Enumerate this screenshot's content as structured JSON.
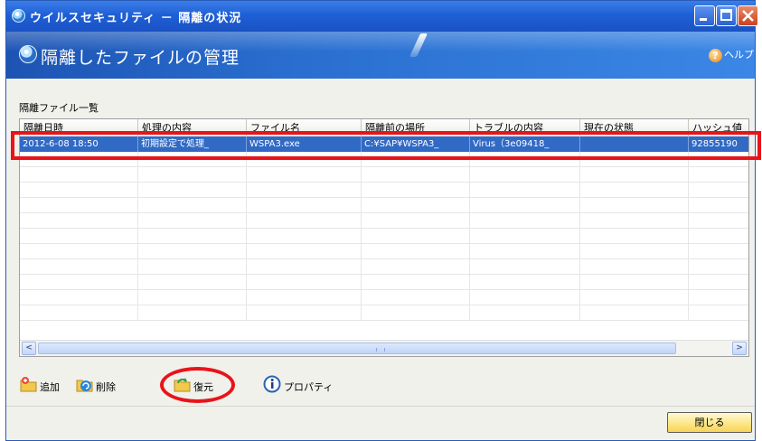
{
  "window": {
    "title": "ウイルスセキュリティ － 隔離の状況",
    "controls": [
      "minimize",
      "maximize",
      "close"
    ]
  },
  "header": {
    "title": "隔離したファイルの管理",
    "help_label": "ヘルプ",
    "help_glyph": "?"
  },
  "list": {
    "label": "隔離ファイル一覧",
    "columns": [
      "隔離日時",
      "処理の内容",
      "ファイル名",
      "隔離前の場所",
      "トラブルの内容",
      "現在の状態",
      "ハッシュ値"
    ],
    "rows": [
      [
        "2012-6-08 18:50",
        "初期設定で処理_",
        "WSPA3.exe",
        "C:¥SAP¥WSPA3_",
        "Virus（3e09418_",
        "",
        "92855190"
      ]
    ],
    "selected_row": 0,
    "scroll_left_glyph": "<",
    "scroll_right_glyph": ">"
  },
  "toolbar": {
    "add_label": "追加",
    "delete_label": "削除",
    "restore_label": "復元",
    "properties_label": "プロパティ"
  },
  "footer": {
    "close_label": "閉じる"
  },
  "colors": {
    "titlebar": "#1f5fd6",
    "header": "#2a6fd0",
    "selection": "#316ac5",
    "annotation_red": "#e8141a",
    "close_button": "#fde482"
  }
}
